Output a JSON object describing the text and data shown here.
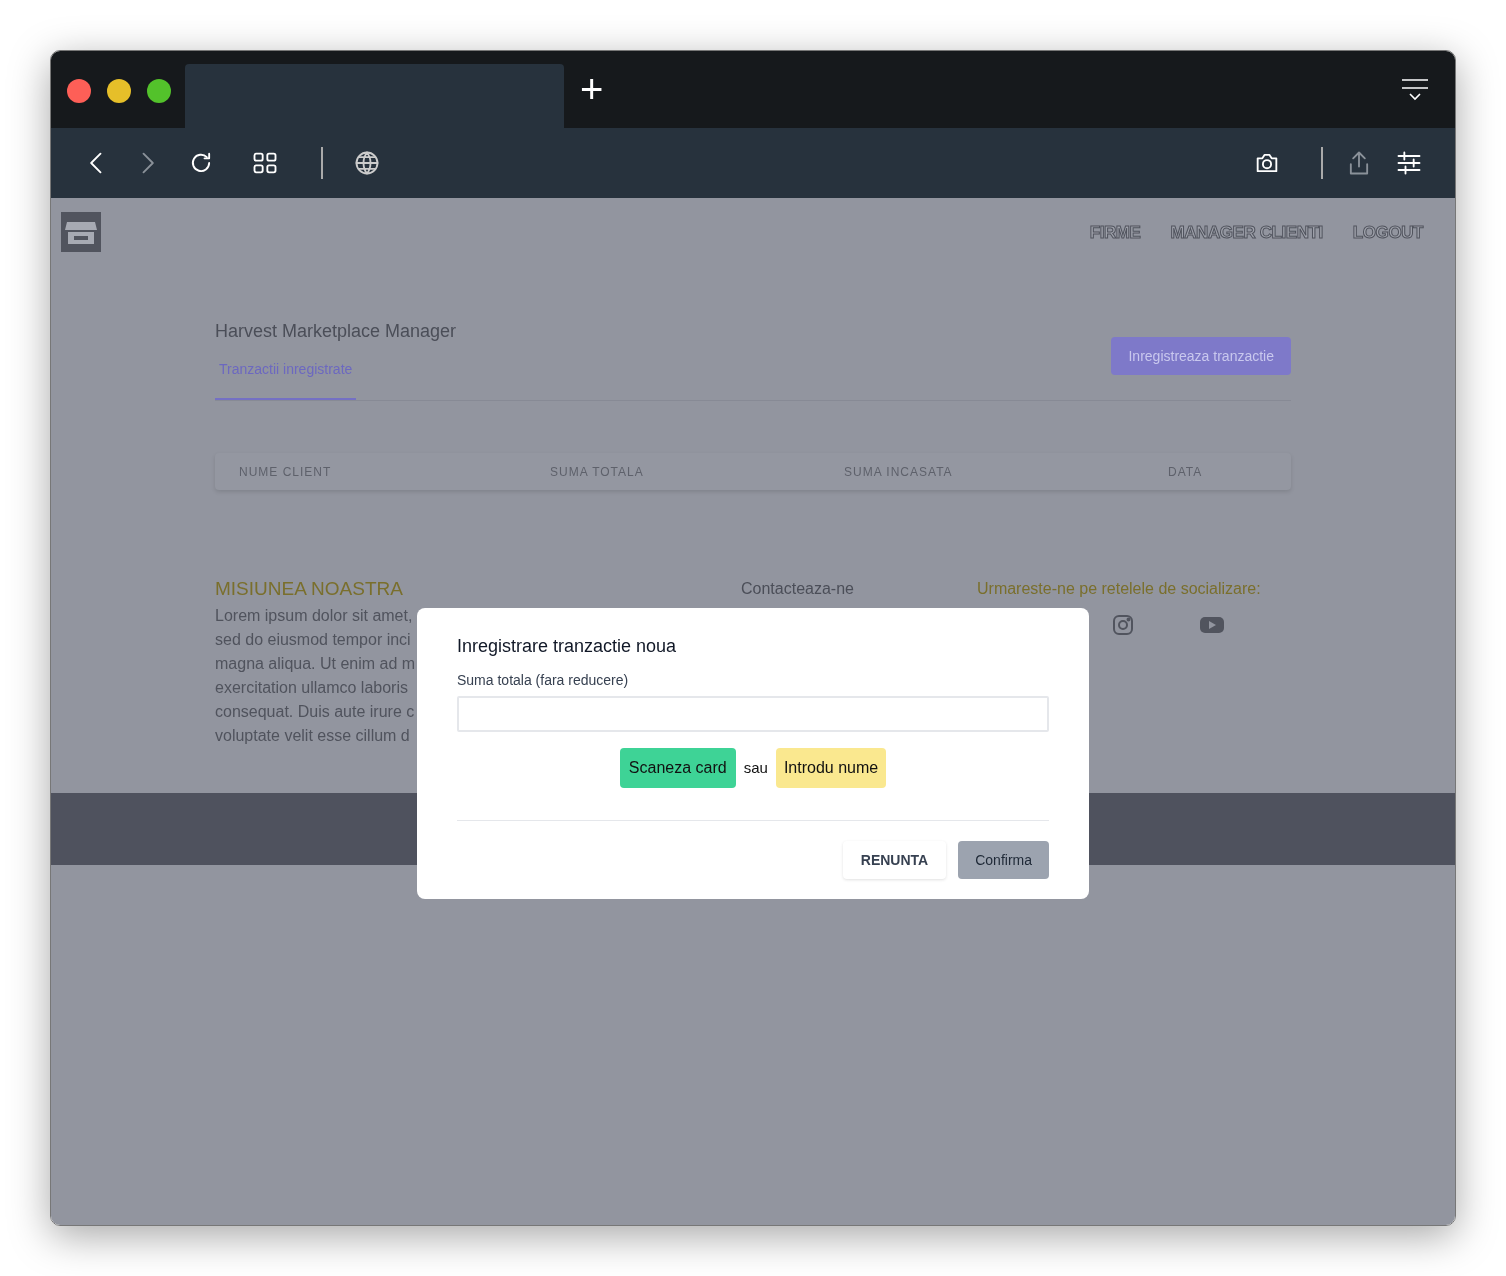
{
  "browser": {
    "new_tab": "+"
  },
  "nav": {
    "links": [
      "FIRME",
      "MANAGER CLIENTI",
      "LOGOUT"
    ]
  },
  "page": {
    "title": "Harvest Marketplace Manager",
    "tabs": [
      {
        "label": "Tranzactii inregistrate",
        "selected": true
      }
    ],
    "action_button": "Inregistreaza tranzactie",
    "table": {
      "columns": [
        "NUME CLIENT",
        "SUMA TOTALA",
        "SUMA INCASATA",
        "DATA"
      ]
    }
  },
  "footer": {
    "mission_title": "MISIUNEA NOASTRA",
    "mission_lines": [
      "Lorem ipsum dolor sit amet,",
      "sed do eiusmod tempor inci",
      "magna aliqua. Ut enim ad m",
      "exercitation ullamco laboris",
      "consequat. Duis aute irure c",
      "voluptate velit esse cillum d"
    ],
    "contact_title": "Contacteaza-ne",
    "social_title": "Urmareste-ne pe retelele de socializare:"
  },
  "modal": {
    "title": "Inregistrare tranzactie noua",
    "field_label": "Suma totala (fara reducere)",
    "scan_button": "Scaneza card",
    "or": "sau",
    "name_button": "Introdu nume",
    "cancel_button": "RENUNTA",
    "confirm_button": "Confirma"
  }
}
